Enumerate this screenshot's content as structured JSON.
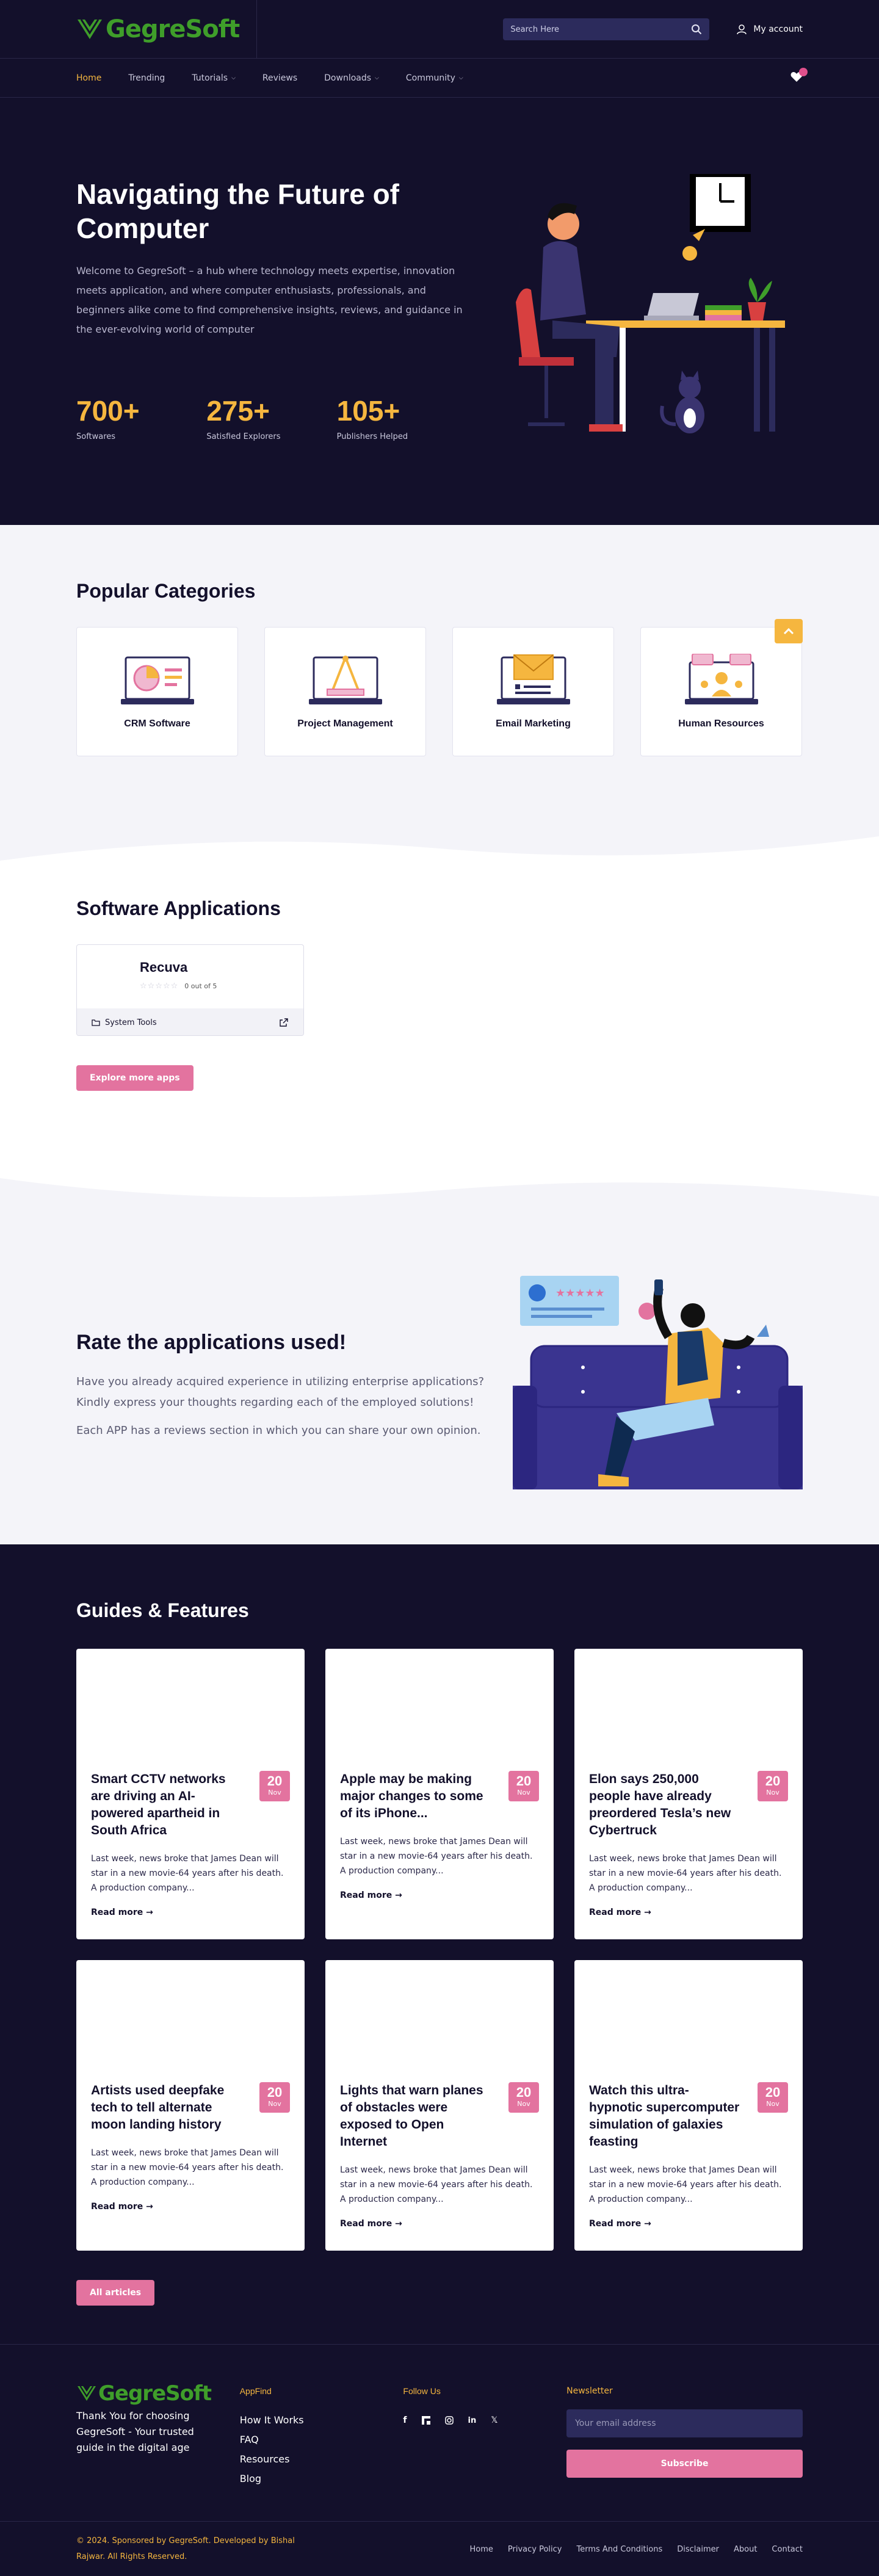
{
  "brand": {
    "name": "GegreSoft",
    "color": "#3f9e2a"
  },
  "header": {
    "search_placeholder": "Search Here",
    "account_label": "My account",
    "cart_count": ""
  },
  "nav": {
    "items": [
      {
        "label": "Home",
        "active": true
      },
      {
        "label": "Trending"
      },
      {
        "label": "Tutorials",
        "dropdown": true
      },
      {
        "label": "Reviews"
      },
      {
        "label": "Downloads",
        "dropdown": true
      },
      {
        "label": "Community",
        "dropdown": true
      }
    ]
  },
  "hero": {
    "title": "Navigating the Future of Computer",
    "text": "Welcome to GegreSoft – a hub where technology meets expertise, innovation meets application, and where computer enthusiasts, professionals, and beginners alike come to find comprehensive insights, reviews, and guidance in the ever-evolving world of computer",
    "stats": [
      {
        "value": "700+",
        "label": "Softwares"
      },
      {
        "value": "275+",
        "label": "Satisfied Explorers"
      },
      {
        "value": "105+",
        "label": "Publishers Helped"
      }
    ]
  },
  "categories": {
    "title": "Popular Categories",
    "items": [
      {
        "label": "CRM Software",
        "icon": "crm-icon"
      },
      {
        "label": "Project Management",
        "icon": "project-icon"
      },
      {
        "label": "Email Marketing",
        "icon": "email-icon"
      },
      {
        "label": "Human Resources",
        "icon": "hr-icon"
      }
    ]
  },
  "apps": {
    "title": "Software Applications",
    "card": {
      "name": "Recuva",
      "rating_text": "0 out of 5",
      "category": "System Tools"
    },
    "button": "Explore more apps"
  },
  "rate": {
    "title": "Rate the applications used!",
    "p1": "Have you already acquired experience in utilizing enterprise applications? Kindly express your thoughts regarding each of the employed solutions!",
    "p2": "Each APP has a reviews section in which you can share your own opinion."
  },
  "guides": {
    "title": "Guides & Features",
    "posts": [
      {
        "title": "Smart CCTV networks are driving an AI-powered apartheid in South Africa",
        "day": "20",
        "month": "Nov",
        "excerpt": "Last week, news broke that James Dean will star in a new movie-64 years after his death. A production company...",
        "read_more": "Read more"
      },
      {
        "title": "Apple may be making major changes to some of its iPhone...",
        "day": "20",
        "month": "Nov",
        "excerpt": "Last week, news broke that James Dean will star in a new movie-64 years after his death. A production company...",
        "read_more": "Read more"
      },
      {
        "title": "Elon says 250,000 people have already preordered Tesla’s new Cybertruck",
        "day": "20",
        "month": "Nov",
        "excerpt": "Last week, news broke that James Dean will star in a new movie-64 years after his death. A production company...",
        "read_more": "Read more"
      },
      {
        "title": "Artists used deepfake tech to tell alternate moon landing history",
        "day": "20",
        "month": "Nov",
        "excerpt": "Last week, news broke that James Dean will star in a new movie-64 years after his death. A production company...",
        "read_more": "Read more"
      },
      {
        "title": "Lights that warn planes of obstacles were exposed to Open Internet",
        "day": "20",
        "month": "Nov",
        "excerpt": "Last week, news broke that James Dean will star in a new movie-64 years after his death. A production company...",
        "read_more": "Read more"
      },
      {
        "title": "Watch this ultra-hypnotic supercomputer simulation of galaxies feasting",
        "day": "20",
        "month": "Nov",
        "excerpt": "Last week, news broke that James Dean will star in a new movie-64 years after his death. A production company...",
        "read_more": "Read more"
      }
    ],
    "button": "All articles"
  },
  "footer": {
    "tagline": "Thank You for choosing GegreSoft - Your trusted guide in the digital age",
    "appfind_title": "AppFind",
    "appfind_links": [
      "How It Works",
      "FAQ",
      "Resources",
      "Blog"
    ],
    "follow_title": "Follow Us",
    "socials": [
      "facebook-icon",
      "flipboard-icon",
      "instagram-icon",
      "linkedin-icon",
      "x-icon"
    ],
    "newsletter_title": "Newsletter",
    "newsletter_placeholder": "Your email address",
    "subscribe_label": "Subscribe",
    "copyright": "© 2024. Sponsored by GegreSoft. Developed by Bishal Rajwar. All Rights Reserved.",
    "bottom_links": [
      "Home",
      "Privacy Policy",
      "Terms And Conditions",
      "Disclaimer",
      "About",
      "Contact"
    ]
  },
  "colors": {
    "accent": "#f5b63f",
    "pink": "#e3739f",
    "dark": "#13102b"
  }
}
